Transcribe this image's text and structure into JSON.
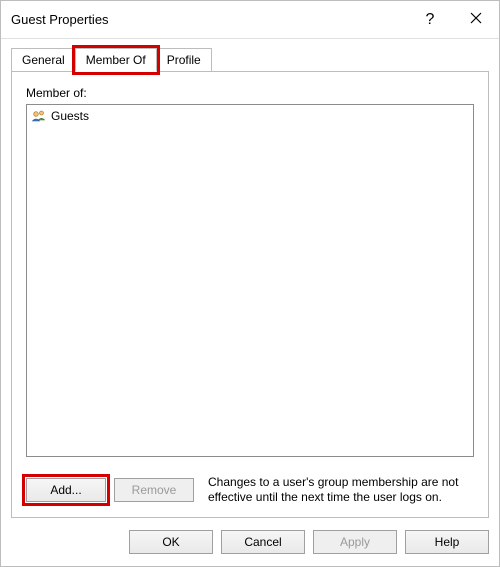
{
  "title": "Guest Properties",
  "tabs": {
    "general": "General",
    "member_of": "Member Of",
    "profile": "Profile",
    "active": "member_of"
  },
  "panel": {
    "label": "Member of:",
    "items": [
      {
        "label": "Guests"
      }
    ],
    "add_label": "Add...",
    "remove_label": "Remove",
    "note": "Changes to a user's group membership are not effective until the next time the user logs on."
  },
  "buttons": {
    "ok": "OK",
    "cancel": "Cancel",
    "apply": "Apply",
    "help": "Help"
  },
  "highlights": {
    "tab_member_of": true,
    "add_button": true
  }
}
